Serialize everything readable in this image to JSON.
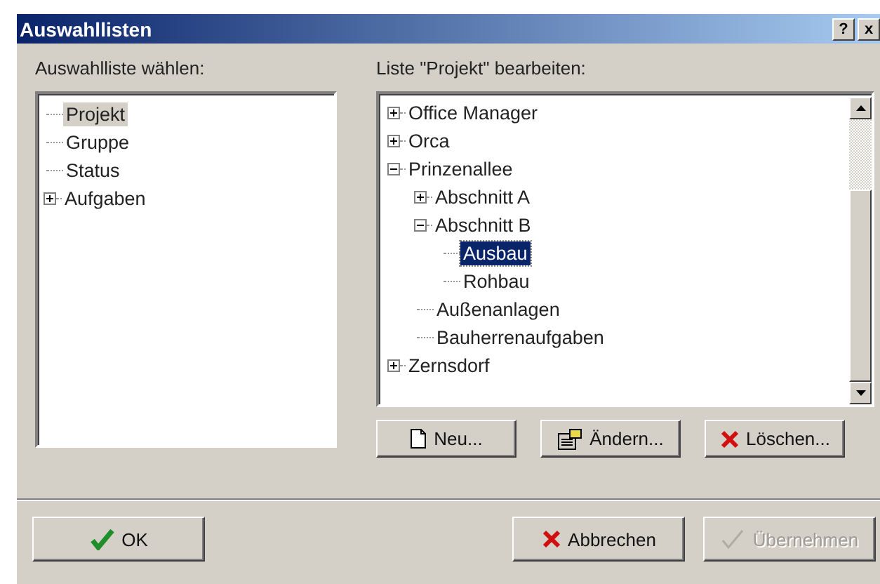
{
  "window": {
    "title": "Auswahllisten",
    "help_button": "?",
    "close_button": "x"
  },
  "left": {
    "label": "Auswahlliste wählen:",
    "tree": [
      {
        "label": "Projekt",
        "kind": "leaf",
        "selected": true
      },
      {
        "label": "Gruppe",
        "kind": "leaf",
        "selected": false
      },
      {
        "label": "Status",
        "kind": "leaf",
        "selected": false
      },
      {
        "label": "Aufgaben",
        "kind": "branch",
        "expanded": false,
        "selected": false
      }
    ]
  },
  "right": {
    "label": "Liste \"Projekt\" bearbeiten:",
    "tree": [
      {
        "label": "Office Manager",
        "kind": "branch",
        "expanded": false,
        "selected": false
      },
      {
        "label": "Orca",
        "kind": "branch",
        "expanded": false,
        "selected": false
      },
      {
        "label": "Prinzenallee",
        "kind": "branch",
        "expanded": true,
        "selected": false,
        "children": [
          {
            "label": "Abschnitt A",
            "kind": "branch",
            "expanded": false,
            "selected": false
          },
          {
            "label": "Abschnitt B",
            "kind": "branch",
            "expanded": true,
            "selected": false,
            "children": [
              {
                "label": "Ausbau",
                "kind": "leaf",
                "selected": true
              },
              {
                "label": "Rohbau",
                "kind": "leaf",
                "selected": false
              }
            ]
          },
          {
            "label": "Außenanlagen",
            "kind": "leaf",
            "selected": false
          },
          {
            "label": "Bauherrenaufgaben",
            "kind": "leaf",
            "selected": false
          }
        ]
      },
      {
        "label": "Zernsdorf",
        "kind": "branch",
        "expanded": false,
        "selected": false
      }
    ],
    "buttons": [
      {
        "label": "Neu...",
        "kind": "new",
        "disabled": false
      },
      {
        "label": "Ändern...",
        "kind": "edit",
        "disabled": false
      },
      {
        "label": "Löschen...",
        "kind": "delete",
        "disabled": false
      }
    ]
  },
  "footer": [
    {
      "label": "OK",
      "kind": "ok",
      "disabled": false
    },
    {
      "label": "Abbrechen",
      "kind": "cancel",
      "disabled": false
    },
    {
      "label": "Übernehmen",
      "kind": "apply",
      "disabled": true
    }
  ]
}
